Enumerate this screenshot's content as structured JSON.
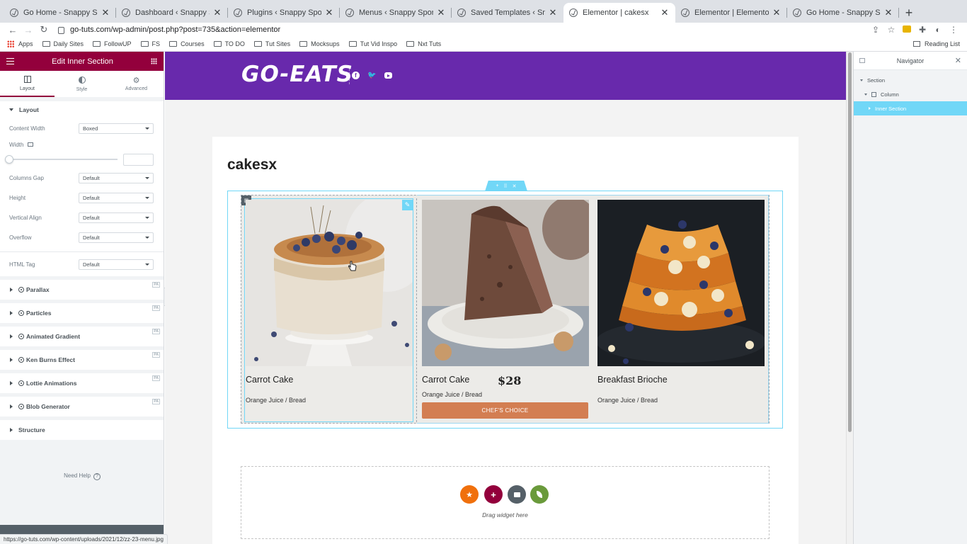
{
  "browser": {
    "tabs": [
      {
        "title": "Go Home - Snappy Sports",
        "active": false
      },
      {
        "title": "Dashboard ‹ Snappy Sports — Wo",
        "active": false
      },
      {
        "title": "Plugins ‹ Snappy Sports — Wo",
        "active": false
      },
      {
        "title": "Menus ‹ Snappy Sports — Wor",
        "active": false
      },
      {
        "title": "Saved Templates ‹ Snappy Spo",
        "active": false
      },
      {
        "title": "Elementor | cakesx",
        "active": true
      },
      {
        "title": "Elementor | Elementor Header",
        "active": false
      },
      {
        "title": "Go Home - Snappy Sports",
        "active": false
      }
    ],
    "url": "go-tuts.com/wp-admin/post.php?post=735&action=elementor",
    "bookmarks": [
      "Apps",
      "Daily Sites",
      "FollowUP",
      "FS",
      "Courses",
      "TO DO",
      "Tut Sites",
      "Mocksups",
      "Tut Vid Inspo",
      "Nxt Tuts"
    ],
    "reading_list": "Reading List",
    "status_url": "https://go-tuts.com/wp-content/uploads/2021/12/zz-23-menu.jpg"
  },
  "panel": {
    "title": "Edit Inner Section",
    "tabs": [
      "Layout",
      "Style",
      "Advanced"
    ],
    "layout_section": "Layout",
    "controls": {
      "content_width": {
        "label": "Content Width",
        "value": "Boxed"
      },
      "width": {
        "label": "Width"
      },
      "columns_gap": {
        "label": "Columns Gap",
        "value": "Default"
      },
      "height": {
        "label": "Height",
        "value": "Default"
      },
      "vertical_align": {
        "label": "Vertical Align",
        "value": "Default"
      },
      "overflow": {
        "label": "Overflow",
        "value": "Default"
      },
      "html_tag": {
        "label": "HTML Tag",
        "value": "Default"
      }
    },
    "collapsed_sections": [
      "Parallax",
      "Particles",
      "Animated Gradient",
      "Ken Burns Effect",
      "Lottie Animations",
      "Blob Generator"
    ],
    "structure_label": "Structure",
    "need_help": "Need Help",
    "pa_badge": "PA"
  },
  "site": {
    "logo": "GO-EATS",
    "page_title": "cakesx",
    "cards": [
      {
        "title": "Carrot Cake",
        "subtitle": "Orange Juice / Bread"
      },
      {
        "title": "Carrot Cake",
        "subtitle": "Orange Juice / Bread",
        "price": "$28",
        "button": "CHEF'S CHOICE"
      },
      {
        "title": "Breakfast Brioche",
        "subtitle": "Orange Juice / Bread"
      }
    ],
    "drop_text": "Drag widget here"
  },
  "navigator": {
    "title": "Navigator",
    "items": [
      "Section",
      "Column",
      "Inner Section"
    ]
  },
  "colors": {
    "panel_header": "#93003c",
    "site_header": "#6829ac",
    "selection": "#71d7f7",
    "chef_button": "#d37e52"
  }
}
